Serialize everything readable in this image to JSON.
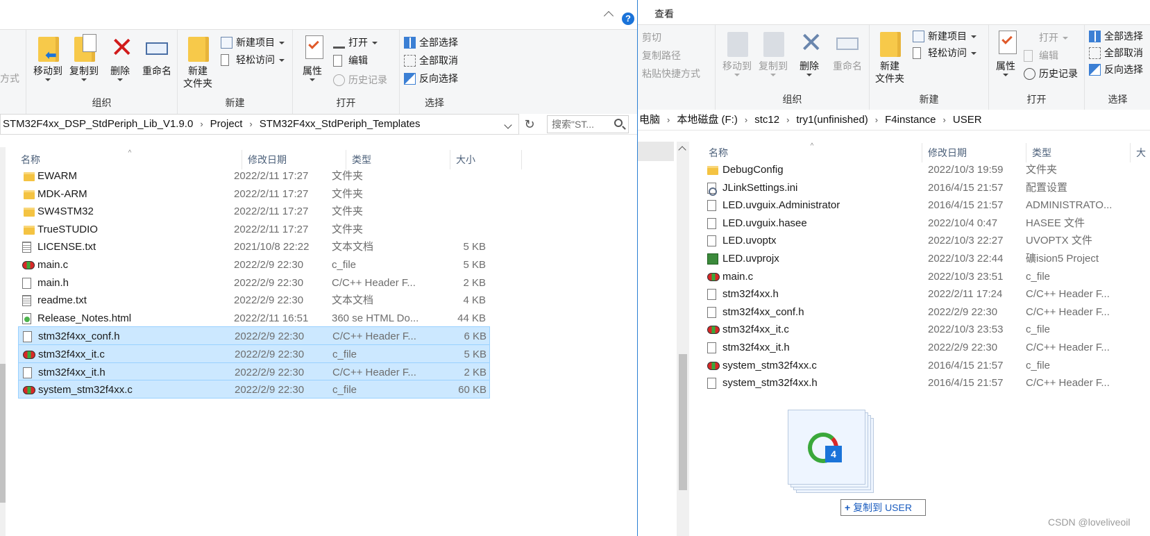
{
  "left": {
    "ribbon": {
      "partial_label": "方式",
      "organize": {
        "label": "组织",
        "move_to": "移动到",
        "copy_to": "复制到",
        "delete": "删除",
        "rename": "重命名"
      },
      "new": {
        "label": "新建",
        "new_folder": "新建\n文件夹",
        "new_item": "新建项目",
        "easy_access": "轻松访问"
      },
      "open": {
        "label": "打开",
        "properties": "属性",
        "open": "打开",
        "edit": "编辑",
        "history": "历史记录"
      },
      "select": {
        "label": "选择",
        "select_all": "全部选择",
        "select_none": "全部取消",
        "invert": "反向选择"
      }
    },
    "address": {
      "crumbs": [
        "STM32F4xx_DSP_StdPeriph_Lib_V1.9.0",
        "Project",
        "STM32F4xx_StdPeriph_Templates"
      ],
      "search_placeholder": "搜索\"ST..."
    },
    "columns": {
      "name": "名称",
      "modified": "修改日期",
      "type": "类型",
      "size": "大小"
    },
    "files": [
      {
        "icon": "folder-icon",
        "name": "EWARM",
        "date": "2022/2/11 17:27",
        "type": "文件夹",
        "size": "",
        "selected": false
      },
      {
        "icon": "folder-icon",
        "name": "MDK-ARM",
        "date": "2022/2/11 17:27",
        "type": "文件夹",
        "size": "",
        "selected": false
      },
      {
        "icon": "folder-icon",
        "name": "SW4STM32",
        "date": "2022/2/11 17:27",
        "type": "文件夹",
        "size": "",
        "selected": false
      },
      {
        "icon": "folder-icon",
        "name": "TrueSTUDIO",
        "date": "2022/2/11 17:27",
        "type": "文件夹",
        "size": "",
        "selected": false
      },
      {
        "icon": "text-file-icon",
        "name": "LICENSE.txt",
        "date": "2021/10/8 22:22",
        "type": "文本文档",
        "size": "5 KB",
        "selected": false
      },
      {
        "icon": "c-file-icon",
        "name": "main.c",
        "date": "2022/2/9 22:30",
        "type": "c_file",
        "size": "5 KB",
        "selected": false
      },
      {
        "icon": "header-file-icon",
        "name": "main.h",
        "date": "2022/2/9 22:30",
        "type": "C/C++ Header F...",
        "size": "2 KB",
        "selected": false
      },
      {
        "icon": "text-file-icon",
        "name": "readme.txt",
        "date": "2022/2/9 22:30",
        "type": "文本文档",
        "size": "4 KB",
        "selected": false
      },
      {
        "icon": "html-file-icon",
        "name": "Release_Notes.html",
        "date": "2022/2/11 16:51",
        "type": "360 se HTML Do...",
        "size": "44 KB",
        "selected": false
      },
      {
        "icon": "header-file-icon",
        "name": "stm32f4xx_conf.h",
        "date": "2022/2/9 22:30",
        "type": "C/C++ Header F...",
        "size": "6 KB",
        "selected": true
      },
      {
        "icon": "c-file-icon",
        "name": "stm32f4xx_it.c",
        "date": "2022/2/9 22:30",
        "type": "c_file",
        "size": "5 KB",
        "selected": true
      },
      {
        "icon": "header-file-icon",
        "name": "stm32f4xx_it.h",
        "date": "2022/2/9 22:30",
        "type": "C/C++ Header F...",
        "size": "2 KB",
        "selected": true
      },
      {
        "icon": "c-file-icon",
        "name": "system_stm32f4xx.c",
        "date": "2022/2/9 22:30",
        "type": "c_file",
        "size": "60 KB",
        "selected": true
      }
    ]
  },
  "right": {
    "tab": "查看",
    "ribbon": {
      "clipboard": {
        "cut": "剪切",
        "copy_path": "复制路径",
        "paste_shortcut": "粘贴快捷方式"
      },
      "organize": {
        "label": "组织",
        "move_to": "移动到",
        "copy_to": "复制到",
        "delete": "删除",
        "rename": "重命名"
      },
      "new": {
        "label": "新建",
        "new_folder": "新建\n文件夹",
        "new_item": "新建项目",
        "easy_access": "轻松访问"
      },
      "open": {
        "label": "打开",
        "properties": "属性",
        "open": "打开",
        "edit": "编辑",
        "history": "历史记录"
      },
      "select": {
        "label": "选择",
        "select_all": "全部选择",
        "select_none": "全部取消",
        "invert": "反向选择"
      }
    },
    "address": {
      "crumbs": [
        "电脑",
        "本地磁盘 (F:)",
        "stc12",
        "try1(unfinished)",
        "F4instance",
        "USER"
      ]
    },
    "columns": {
      "name": "名称",
      "modified": "修改日期",
      "type": "类型",
      "size": "大"
    },
    "files": [
      {
        "icon": "folder-icon",
        "name": "DebugConfig",
        "date": "2022/10/3 19:59",
        "type": "文件夹"
      },
      {
        "icon": "settings-file-icon",
        "name": "JLinkSettings.ini",
        "date": "2016/4/15 21:57",
        "type": "配置设置"
      },
      {
        "icon": "blank-file-icon",
        "name": "LED.uvguix.Administrator",
        "date": "2016/4/15 21:57",
        "type": "ADMINISTRATO..."
      },
      {
        "icon": "blank-file-icon",
        "name": "LED.uvguix.hasee",
        "date": "2022/10/4 0:47",
        "type": "HASEE 文件"
      },
      {
        "icon": "blank-file-icon",
        "name": "LED.uvoptx",
        "date": "2022/10/3 22:27",
        "type": "UVOPTX 文件"
      },
      {
        "icon": "keil-project-icon",
        "name": "LED.uvprojx",
        "date": "2022/10/3 22:44",
        "type": "礦ision5 Project"
      },
      {
        "icon": "c-file-icon",
        "name": "main.c",
        "date": "2022/10/3 23:51",
        "type": "c_file"
      },
      {
        "icon": "header-file-icon",
        "name": "stm32f4xx.h",
        "date": "2022/2/11 17:24",
        "type": "C/C++ Header F..."
      },
      {
        "icon": "header-file-icon",
        "name": "stm32f4xx_conf.h",
        "date": "2022/2/9 22:30",
        "type": "C/C++ Header F..."
      },
      {
        "icon": "c-file-icon",
        "name": "stm32f4xx_it.c",
        "date": "2022/10/3 23:53",
        "type": "c_file"
      },
      {
        "icon": "header-file-icon",
        "name": "stm32f4xx_it.h",
        "date": "2022/2/9 22:30",
        "type": "C/C++ Header F..."
      },
      {
        "icon": "c-file-icon",
        "name": "system_stm32f4xx.c",
        "date": "2016/4/15 21:57",
        "type": "c_file"
      },
      {
        "icon": "header-file-icon",
        "name": "system_stm32f4xx.h",
        "date": "2016/4/15 21:57",
        "type": "C/C++ Header F..."
      }
    ]
  },
  "drag": {
    "count": "4",
    "tooltip_plus": "+",
    "tooltip": "复制到 USER"
  },
  "watermark": "CSDN @loveliveoil",
  "colors": {
    "selection_bg": "#cce8ff",
    "selection_border": "#99d1ff",
    "window_border": "#2a7fd4",
    "accent": "#1a73d9"
  }
}
